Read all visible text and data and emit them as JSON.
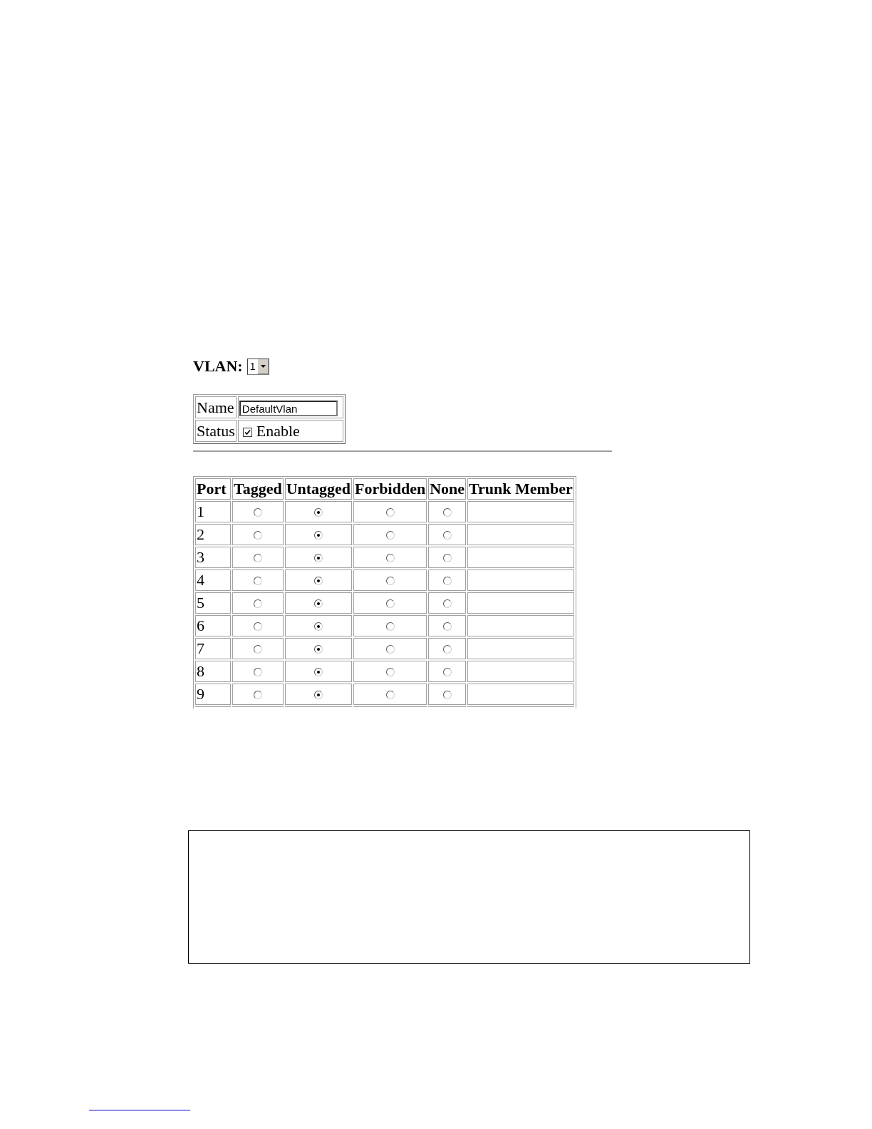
{
  "vlan": {
    "label": "VLAN:",
    "value": "1"
  },
  "settings": {
    "name_label": "Name",
    "name_value": "DefaultVlan",
    "status_label": "Status",
    "enable": {
      "label": "Enable",
      "checked": true
    }
  },
  "ports_table": {
    "columns": [
      "Port",
      "Tagged",
      "Untagged",
      "Forbidden",
      "None",
      "Trunk Member"
    ],
    "rows": [
      {
        "port": "1",
        "choices": [
          {
            "selected": false
          },
          {
            "selected": true
          },
          {
            "selected": false
          },
          {
            "selected": false
          }
        ]
      },
      {
        "port": "2",
        "choices": [
          {
            "selected": false
          },
          {
            "selected": true
          },
          {
            "selected": false
          },
          {
            "selected": false
          }
        ]
      },
      {
        "port": "3",
        "choices": [
          {
            "selected": false
          },
          {
            "selected": true
          },
          {
            "selected": false
          },
          {
            "selected": false
          }
        ]
      },
      {
        "port": "4",
        "choices": [
          {
            "selected": false
          },
          {
            "selected": true
          },
          {
            "selected": false
          },
          {
            "selected": false
          }
        ]
      },
      {
        "port": "5",
        "choices": [
          {
            "selected": false
          },
          {
            "selected": true
          },
          {
            "selected": false
          },
          {
            "selected": false
          }
        ]
      },
      {
        "port": "6",
        "choices": [
          {
            "selected": false
          },
          {
            "selected": true
          },
          {
            "selected": false
          },
          {
            "selected": false
          }
        ]
      },
      {
        "port": "7",
        "choices": [
          {
            "selected": false
          },
          {
            "selected": true
          },
          {
            "selected": false
          },
          {
            "selected": false
          }
        ]
      },
      {
        "port": "8",
        "choices": [
          {
            "selected": false
          },
          {
            "selected": true
          },
          {
            "selected": false
          },
          {
            "selected": false
          }
        ]
      },
      {
        "port": "9",
        "choices": [
          {
            "selected": false
          },
          {
            "selected": true
          },
          {
            "selected": false
          },
          {
            "selected": false
          }
        ]
      }
    ]
  }
}
